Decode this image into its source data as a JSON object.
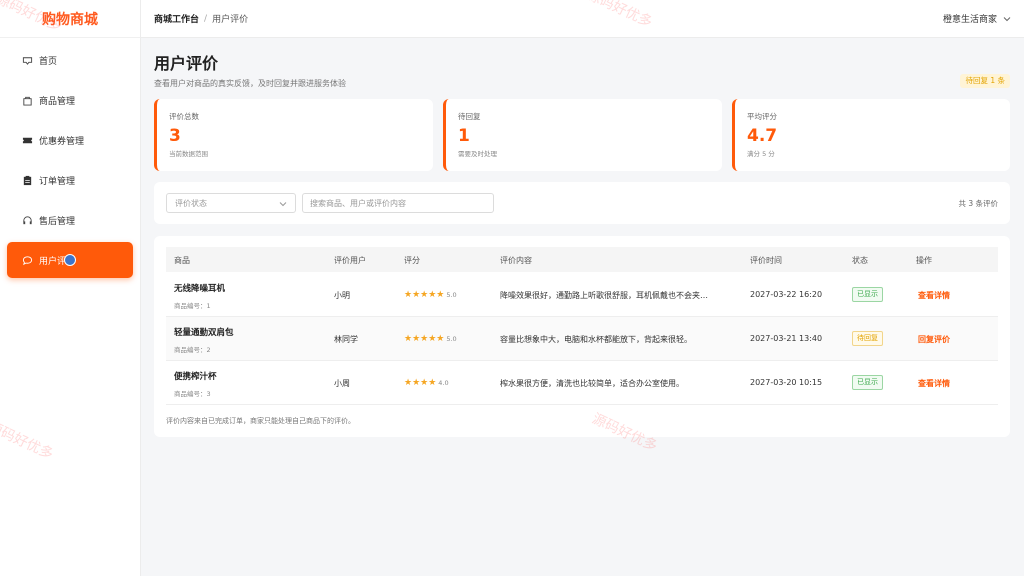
{
  "app": {
    "logo": "购物商城"
  },
  "sidebar": {
    "items": [
      {
        "label": "首页",
        "icon": "home-icon"
      },
      {
        "label": "商品管理",
        "icon": "bag-icon"
      },
      {
        "label": "优惠券管理",
        "icon": "ticket-icon"
      },
      {
        "label": "订单管理",
        "icon": "clipboard-icon"
      },
      {
        "label": "售后管理",
        "icon": "headset-icon"
      },
      {
        "label": "用户评价",
        "icon": "chat-icon",
        "active": true
      }
    ]
  },
  "topbar": {
    "breadcrumb_root": "商城工作台",
    "breadcrumb_sep": "/",
    "breadcrumb_current": "用户评价",
    "merchant": "橙意生活商家"
  },
  "page": {
    "title": "用户评价",
    "subtitle": "查看用户对商品的真实反馈，及时回复并跟进服务体验",
    "pending_badge": "待回复 1 条"
  },
  "stats": [
    {
      "label": "评价总数",
      "value": "3",
      "hint": "当前数据范围"
    },
    {
      "label": "待回复",
      "value": "1",
      "hint": "需要及时处理"
    },
    {
      "label": "平均评分",
      "value": "4.7",
      "hint": "满分 5 分"
    }
  ],
  "filter": {
    "status_placeholder": "评价状态",
    "search_placeholder": "搜索商品、用户或评价内容",
    "count": "共 3 条评价"
  },
  "table": {
    "headers": [
      "商品",
      "评价用户",
      "评分",
      "评价内容",
      "评价时间",
      "状态",
      "操作"
    ],
    "rows": [
      {
        "product": "无线降噪耳机",
        "pid": "商品编号：1",
        "user": "小明",
        "stars": "★★★★★",
        "score": "5.0",
        "content": "降噪效果很好，通勤路上听歌很舒服，耳机佩戴也不会夹…",
        "time": "2027-03-22 16:20",
        "status": "已显示",
        "status_type": "shown",
        "action": "查看详情"
      },
      {
        "product": "轻量通勤双肩包",
        "pid": "商品编号：2",
        "user": "林同学",
        "stars": "★★★★★",
        "score": "5.0",
        "content": "容量比想象中大，电脑和水杯都能放下，背起来很轻。",
        "time": "2027-03-21 13:40",
        "status": "待回复",
        "status_type": "wait",
        "action": "回复评价"
      },
      {
        "product": "便携榨汁杯",
        "pid": "商品编号：3",
        "user": "小周",
        "stars": "★★★★",
        "score": "4.0",
        "content": "榨水果很方便，清洗也比较简单，适合办公室使用。",
        "time": "2027-03-20 10:15",
        "status": "已显示",
        "status_type": "shown",
        "action": "查看详情"
      }
    ],
    "footnote": "评价内容来自已完成订单，商家只能处理自己商品下的评价。"
  },
  "watermark": "源码好优多",
  "colors": {
    "accent": "#ff5a0a",
    "star": "#f5a623",
    "shown": "#3aa84b",
    "wait": "#e3a300"
  }
}
